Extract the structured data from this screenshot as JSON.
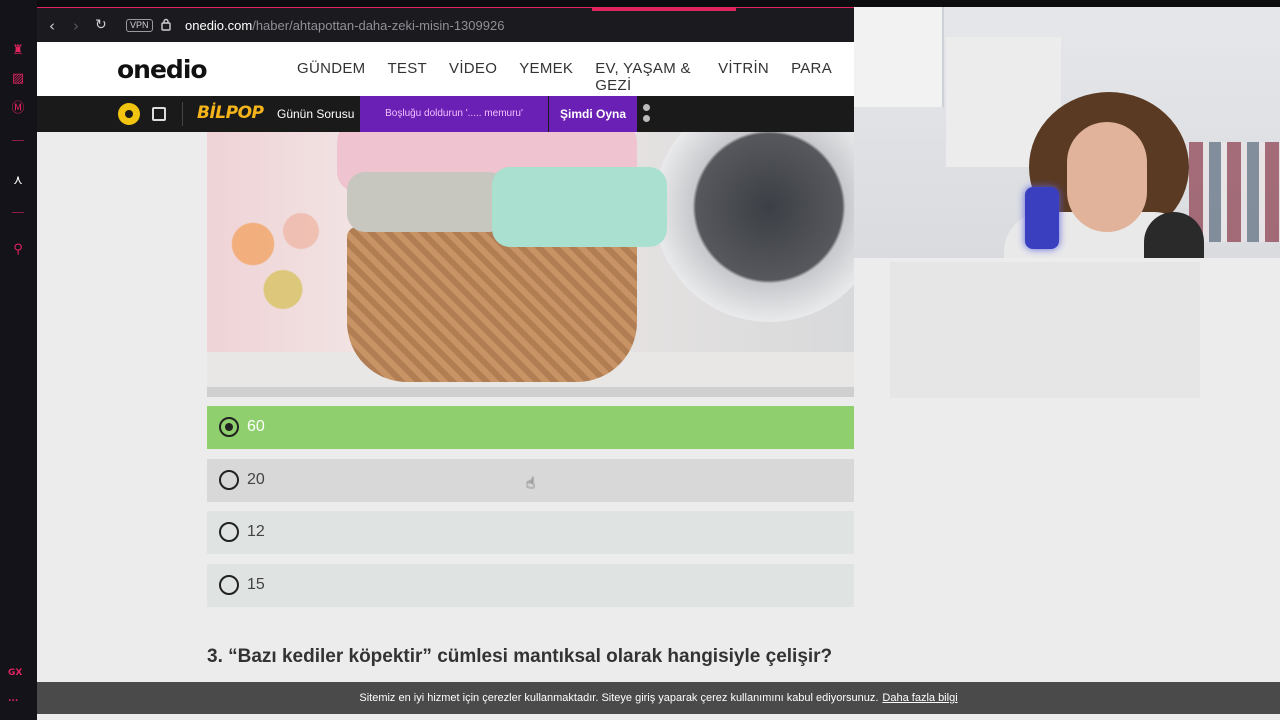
{
  "browser": {
    "vpn_label": "VPN",
    "url_host": "onedio.com",
    "url_path": "/haber/ahtapottan-daha-zeki-misin-1309926"
  },
  "sidebar": {
    "gx_label": "GX",
    "more_label": "..."
  },
  "site": {
    "logo": "onedio",
    "nav": [
      "GÜNDEM",
      "TEST",
      "VİDEO",
      "YEMEK",
      "EV, YAŞAM & GEZİ",
      "VİTRİN",
      "PARA"
    ]
  },
  "promo": {
    "brand": "BİLPOP",
    "daily_question": "Günün Sorusu",
    "question_text": "Boşluğu doldurun '..... memuru'",
    "play_label": "Şimdi Oyna"
  },
  "quiz": {
    "options": [
      {
        "label": "60",
        "selected": true
      },
      {
        "label": "20",
        "selected": false
      },
      {
        "label": "12",
        "selected": false
      },
      {
        "label": "15",
        "selected": false
      }
    ],
    "next_question": "3. “Bazı kediler köpektir” cümlesi mantıksal olarak hangisiyle çelişir?"
  },
  "cookie": {
    "message": "Sitemiz en iyi hizmet için çerezler kullanmaktadır. Siteye giriş yaparak çerez kullanımını kabul ediyorsunuz.",
    "link": "Daha fazla bilgi"
  },
  "colors": {
    "accent": "#e0245e",
    "selected_option": "#8fcf6e",
    "promo_purple": "#6a1fb5",
    "bilpop_yellow": "#f5b41a"
  }
}
